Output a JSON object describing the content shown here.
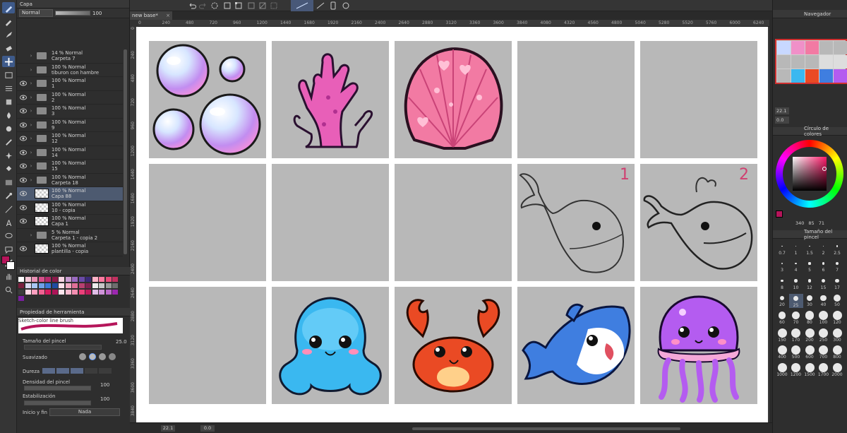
{
  "document": {
    "tab_label": "new base*"
  },
  "layer_panel": {
    "title": "Capa",
    "blend_mode": "Normal",
    "opacity": "100",
    "layers": [
      {
        "mode": "14 % Normal",
        "name": "Carpeta 7",
        "type": "folder",
        "visible": false
      },
      {
        "mode": "100 % Normal",
        "name": "tiburon con hambre",
        "type": "folder",
        "visible": false
      },
      {
        "mode": "100 % Normal",
        "name": "1",
        "type": "folder",
        "visible": true
      },
      {
        "mode": "100 % Normal",
        "name": "2",
        "type": "folder",
        "visible": true
      },
      {
        "mode": "100 % Normal",
        "name": "3",
        "type": "folder",
        "visible": true
      },
      {
        "mode": "100 % Normal",
        "name": "9",
        "type": "folder",
        "visible": true
      },
      {
        "mode": "100 % Normal",
        "name": "12",
        "type": "folder",
        "visible": true
      },
      {
        "mode": "100 % Normal",
        "name": "14",
        "type": "folder",
        "visible": true
      },
      {
        "mode": "100 % Normal",
        "name": "15",
        "type": "folder",
        "visible": true
      },
      {
        "mode": "100 % Normal",
        "name": "Carpeta 18",
        "type": "folder",
        "visible": true
      },
      {
        "mode": "100 % Normal",
        "name": "Capa 88",
        "type": "raster",
        "visible": true,
        "selected": true
      },
      {
        "mode": "100 % Normal",
        "name": "10 - copia",
        "type": "raster",
        "visible": true
      },
      {
        "mode": "100 % Normal",
        "name": "Capa 1",
        "type": "raster",
        "visible": true
      },
      {
        "mode": "5 % Normal",
        "name": "Carpeta 1 - copia 2",
        "type": "folder",
        "visible": false
      },
      {
        "mode": "100 % Normal",
        "name": "plantilla - copia",
        "type": "raster",
        "visible": true
      }
    ]
  },
  "color_history": {
    "title": "Historial de color",
    "colors": [
      "#ffffff",
      "#f4c6d6",
      "#e891b4",
      "#d64f8a",
      "#b72a6b",
      "#8b1a4a",
      "#f7d4e2",
      "#c99ad0",
      "#9b6bc2",
      "#6a4aa8",
      "#3a2a78",
      "#ffb3c7",
      "#ff7aa0",
      "#e84a78",
      "#c23060",
      "#7a1f3d",
      "#d9d9f0",
      "#a8c6f2",
      "#6fa1e8",
      "#3c78d8",
      "#1f4ca0",
      "#fde0ea",
      "#f0a8c0",
      "#e07098",
      "#b84070",
      "#802050",
      "#ededed",
      "#c7c7c7",
      "#9a9a9a",
      "#6e6e6e",
      "#3c3c3c",
      "#ffd9e6",
      "#ff9fbf",
      "#f06292",
      "#d81b60",
      "#ad1457",
      "#fce4ec",
      "#f8bbd0",
      "#f48fb1",
      "#ec407a",
      "#c2185b",
      "#e1bee7",
      "#ce93d8",
      "#ba68c8",
      "#9c27b0",
      "#7b1fa2"
    ]
  },
  "tool_property": {
    "title": "Propiedad de herramienta",
    "brush_name": "Sketch-color line brush",
    "size_label": "Tamaño del pincel",
    "size_value": "25.0",
    "smoothing_label": "Suavizado",
    "hardness_label": "Dureza",
    "density_label": "Densidad del pincel",
    "density_value": "100",
    "stabilization_label": "Estabilización",
    "stabilization_value": "100",
    "start_end_label": "Inicio y fin",
    "start_end_value": "Nada"
  },
  "navigator": {
    "title": "Navegador",
    "zoom": "22.1",
    "angle": "0.0"
  },
  "color_wheel": {
    "title": "Círculo de colores",
    "h": "340",
    "s": "85",
    "v": "71",
    "fg_color": "#b5155a",
    "bg_color": "#ffffff"
  },
  "brush_size": {
    "title": "Tamaño del pincel",
    "sizes": [
      "0.7",
      "1",
      "1.5",
      "2",
      "2.5",
      "3",
      "4",
      "5",
      "6",
      "7",
      "8",
      "10",
      "12",
      "15",
      "17",
      "20",
      "25",
      "30",
      "40",
      "50",
      "60",
      "70",
      "80",
      "100",
      "120",
      "150",
      "170",
      "200",
      "250",
      "300",
      "400",
      "500",
      "600",
      "700",
      "800",
      "1000",
      "1200",
      "1500",
      "1700",
      "2000"
    ]
  },
  "status": {
    "zoom": "22.1",
    "angle": "0.0"
  },
  "canvas": {
    "rulers_top": [
      "0",
      "240",
      "480",
      "720",
      "960",
      "1200",
      "1440",
      "1680",
      "1920",
      "2160",
      "2400",
      "2640",
      "2880",
      "3120",
      "3360",
      "3600",
      "3840",
      "4080",
      "4320",
      "4560",
      "4800",
      "5040",
      "5280",
      "5520",
      "5760",
      "6000",
      "6240"
    ],
    "rulers_left": [
      "0",
      "240",
      "480",
      "720",
      "960",
      "1200",
      "1440",
      "1680",
      "1920",
      "2160",
      "2400",
      "2640",
      "2880",
      "3120",
      "3360",
      "3600",
      "3840"
    ],
    "annotation_1": "1",
    "annotation_2": "2"
  }
}
